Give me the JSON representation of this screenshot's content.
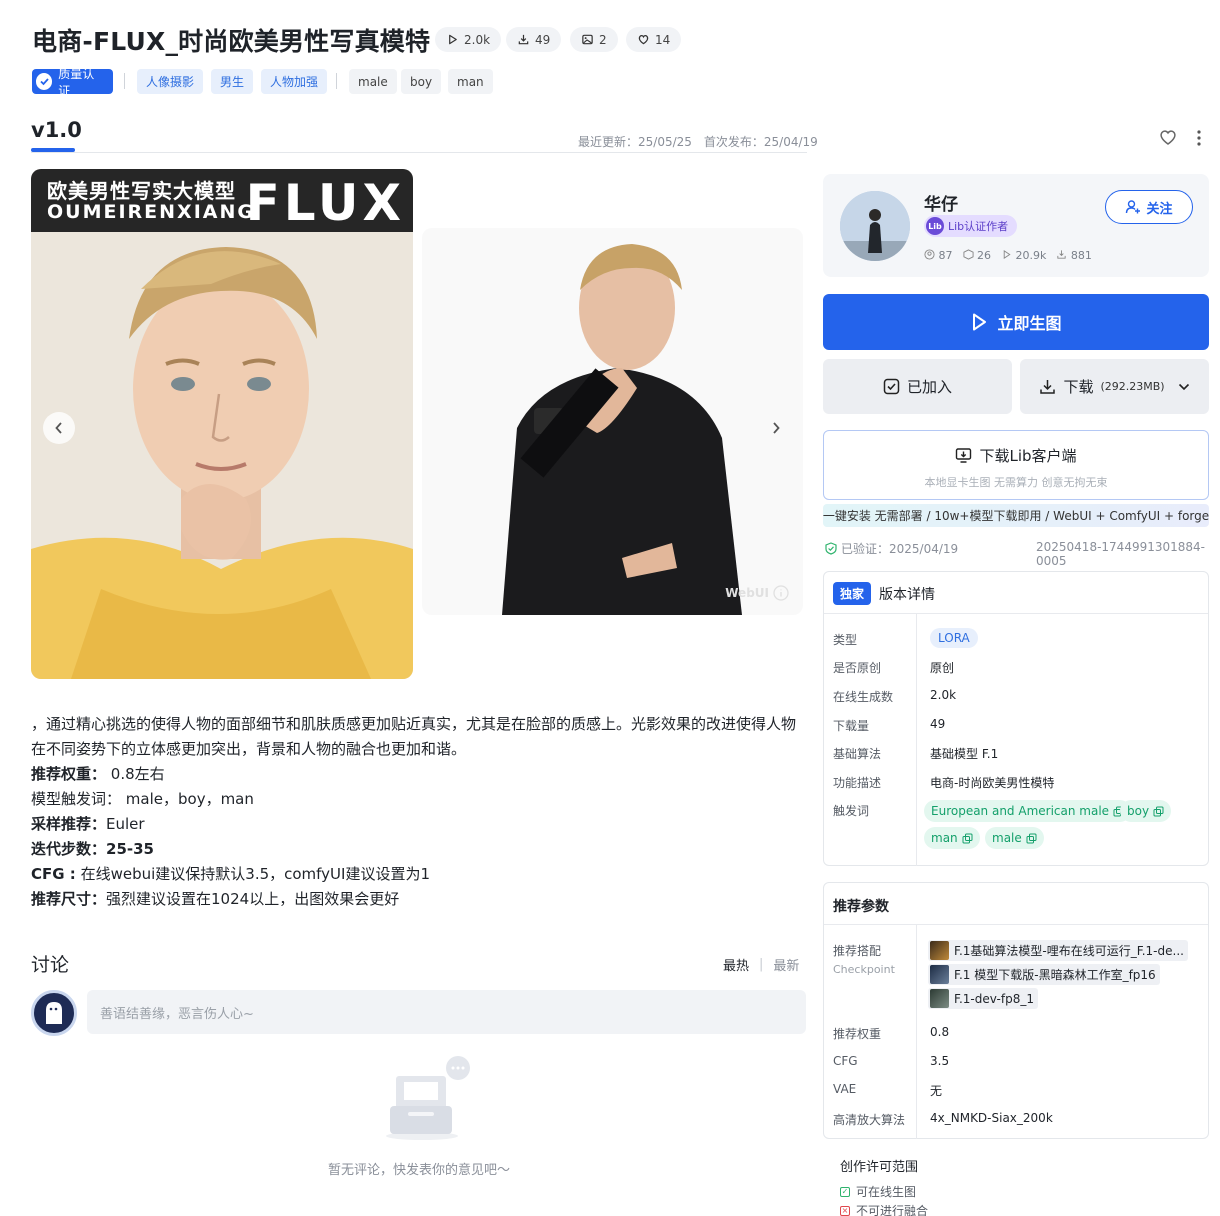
{
  "header": {
    "title": "电商-FLUX_时尚欧美男性写真模特",
    "stats": [
      {
        "icon": "play-icon",
        "value": "2.0k"
      },
      {
        "icon": "download-icon",
        "value": "49"
      },
      {
        "icon": "image-icon",
        "value": "2"
      },
      {
        "icon": "heart-icon",
        "value": "14"
      }
    ],
    "quality_tag": "质量认证",
    "category_tags": [
      "人像摄影",
      "男生",
      "人物加强"
    ],
    "keyword_tags": [
      "male",
      "boy",
      "man"
    ]
  },
  "version": {
    "label": "v1.0",
    "updated": "最近更新：25/05/25",
    "published": "首次发布：25/04/19"
  },
  "gallery": {
    "banner_cn": "欧美男性写实大模型",
    "banner_en": "OUMEIRENXIANG",
    "banner_logo": "FLUX",
    "watermark": "WebUI"
  },
  "description": {
    "intro": "，通过精心挑选的使得人物的面部细节和肌肤质感更加贴近真实，尤其是在脸部的质感上。光影效果的改进使得人物在不同姿势下的立体感更加突出，背景和人物的融合也更加和谐。",
    "weight_label": "推荐权重：",
    "weight_value": "0.8左右",
    "trigger_label": "模型触发词：",
    "trigger_value": "male，boy，man",
    "sampler_label": "采样推荐：",
    "sampler_value": "Euler",
    "steps_label": "迭代步数：",
    "steps_value": "25-35",
    "cfg_label": "CFG :",
    "cfg_value": "在线webui建议保持默认3.5，comfyUI建议设置为1",
    "size_label": "推荐尺寸：",
    "size_value": "强烈建议设置在1024以上，出图效果会更好"
  },
  "discussion": {
    "title": "讨论",
    "sort_hot": "最热",
    "sort_new": "最新",
    "placeholder": "善语结善缘，恶言伤人心~",
    "empty": "暂无评论，快发表你的意见吧～"
  },
  "author": {
    "name": "华仔",
    "badge": "Lib认证作者",
    "stats": [
      "87",
      "26",
      "20.9k",
      "881"
    ],
    "follow": "关注"
  },
  "actions": {
    "generate": "立即生图",
    "added": "已加入",
    "download": "下载",
    "download_size": "(292.23MB)",
    "client_title": "下载Lib客户端",
    "client_sub": "本地显卡生图 无需算力 创意无拘无束",
    "client_strip": "一键安装 无需部署 / 10w+模型下载即用 / WebUI + ComfyUI + forge"
  },
  "verify": {
    "text": "已验证：2025/04/19",
    "id": "20250418-1744991301884-0005"
  },
  "details": {
    "exclusive": "独家",
    "title": "版本详情",
    "rows": [
      {
        "label": "类型",
        "value": "LORA"
      },
      {
        "label": "是否原创",
        "value": "原创"
      },
      {
        "label": "在线生成数",
        "value": "2.0k"
      },
      {
        "label": "下载量",
        "value": "49"
      },
      {
        "label": "基础算法",
        "value": "基础模型 F.1"
      },
      {
        "label": "功能描述",
        "value": "电商-时尚欧美男性模特"
      },
      {
        "label": "触发词",
        "value": ""
      }
    ],
    "triggers": [
      "European and American male",
      "boy",
      "man",
      "male"
    ]
  },
  "params": {
    "title": "推荐参数",
    "checkpoint_label": "推荐搭配",
    "checkpoint_sub": "Checkpoint",
    "checkpoints": [
      "F.1基础算法模型-哩布在线可运行_F.1-de...",
      "F.1 模型下载版-黑暗森林工作室_fp16",
      "F.1-dev-fp8_1"
    ],
    "rows": [
      {
        "label": "推荐权重",
        "value": "0.8"
      },
      {
        "label": "CFG",
        "value": "3.5"
      },
      {
        "label": "VAE",
        "value": "无"
      },
      {
        "label": "高清放大算法",
        "value": "4x_NMKD-Siax_200k"
      }
    ]
  },
  "license": {
    "title": "创作许可范围",
    "items": [
      "可在线生图",
      "不可进行融合"
    ]
  },
  "colors": {
    "accent": "#2463eb",
    "trigger_green": "#14a06b"
  }
}
